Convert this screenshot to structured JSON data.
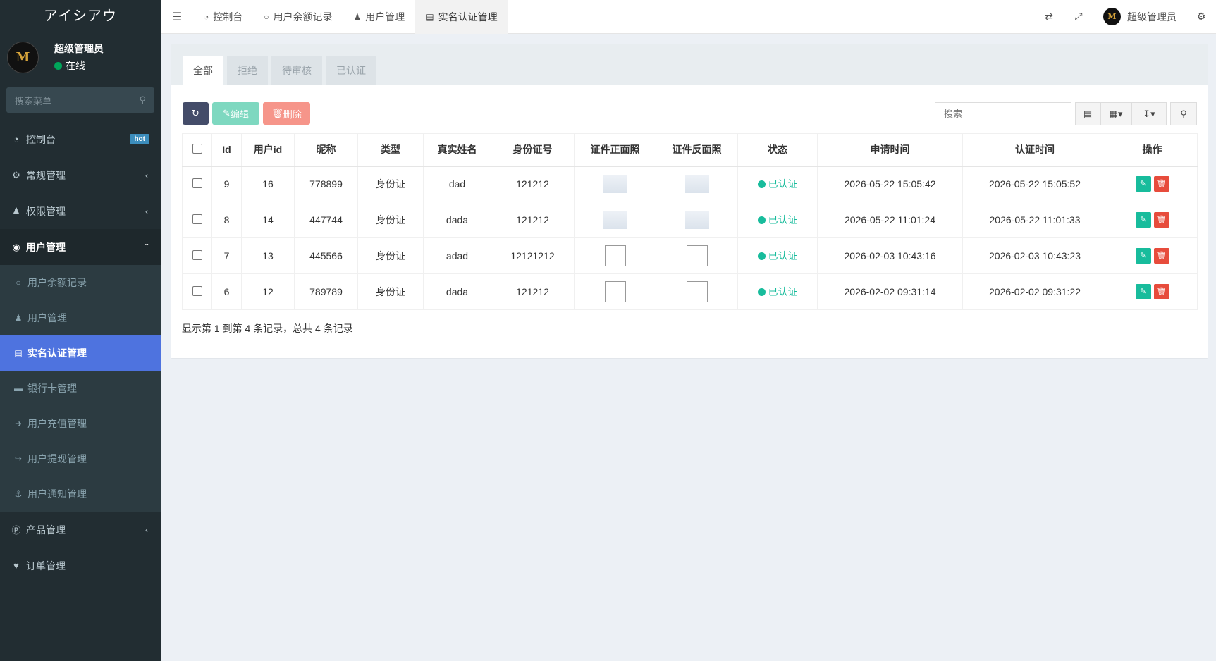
{
  "sidebar": {
    "logo": "アイシアウ",
    "user_name": "超级管理员",
    "user_status": "在线",
    "search_placeholder": "搜索菜单",
    "items": [
      {
        "label": "控制台",
        "badge": "hot"
      },
      {
        "label": "常规管理"
      },
      {
        "label": "权限管理"
      },
      {
        "label": "用户管理"
      },
      {
        "label": "产品管理"
      },
      {
        "label": "订单管理"
      }
    ],
    "subitems": [
      {
        "label": "用户余额记录"
      },
      {
        "label": "用户管理"
      },
      {
        "label": "实名认证管理"
      },
      {
        "label": "银行卡管理"
      },
      {
        "label": "用户充值管理"
      },
      {
        "label": "用户提现管理"
      },
      {
        "label": "用户通知管理"
      }
    ]
  },
  "topbar": {
    "tabs": [
      {
        "label": "控制台"
      },
      {
        "label": "用户余额记录"
      },
      {
        "label": "用户管理"
      },
      {
        "label": "实名认证管理"
      }
    ],
    "user_name": "超级管理员"
  },
  "filter_tabs": [
    "全部",
    "拒绝",
    "待审核",
    "已认证"
  ],
  "toolbar": {
    "edit_label": "编辑",
    "delete_label": "删除",
    "search_placeholder": "搜索"
  },
  "table": {
    "headers": [
      "Id",
      "用户id",
      "昵称",
      "类型",
      "真实姓名",
      "身份证号",
      "证件正面照",
      "证件反面照",
      "状态",
      "申请时间",
      "认证时间",
      "操作"
    ],
    "rows": [
      {
        "id": "9",
        "user_id": "16",
        "nickname": "778899",
        "type": "身份证",
        "real_name": "dad",
        "id_number": "121212",
        "status": "已认证",
        "apply_time": "2026-05-22 15:05:42",
        "verify_time": "2026-05-22 15:05:52"
      },
      {
        "id": "8",
        "user_id": "14",
        "nickname": "447744",
        "type": "身份证",
        "real_name": "dada",
        "id_number": "121212",
        "status": "已认证",
        "apply_time": "2026-05-22 11:01:24",
        "verify_time": "2026-05-22 11:01:33"
      },
      {
        "id": "7",
        "user_id": "13",
        "nickname": "445566",
        "type": "身份证",
        "real_name": "adad",
        "id_number": "12121212",
        "status": "已认证",
        "apply_time": "2026-02-03 10:43:16",
        "verify_time": "2026-02-03 10:43:23"
      },
      {
        "id": "6",
        "user_id": "12",
        "nickname": "789789",
        "type": "身份证",
        "real_name": "dada",
        "id_number": "121212",
        "status": "已认证",
        "apply_time": "2026-02-02 09:31:14",
        "verify_time": "2026-02-02 09:31:22"
      }
    ]
  },
  "pagination_text": "显示第 1 到第 4 条记录，总共 4 条记录"
}
